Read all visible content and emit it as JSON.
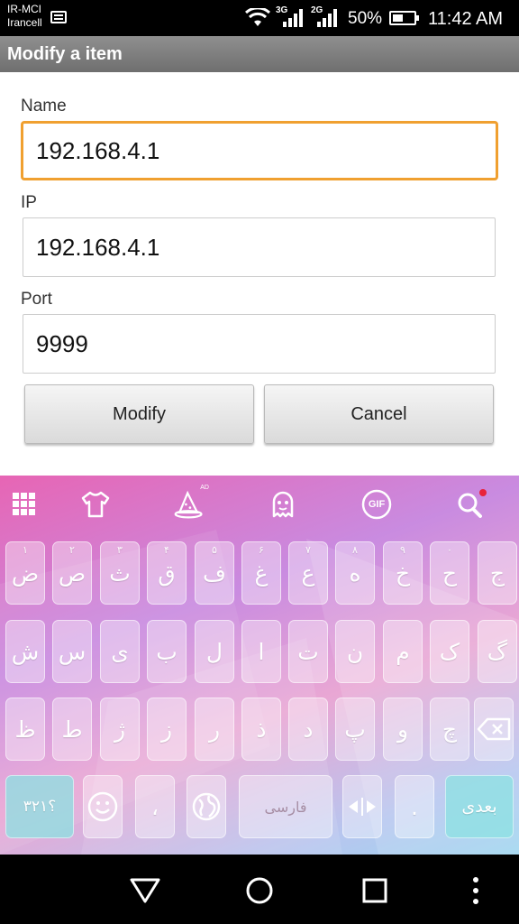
{
  "status_bar": {
    "carrier_line1": "IR-MCI",
    "carrier_line2": "Irancell",
    "network1": "3G",
    "network2": "2G",
    "battery_percent": "50%",
    "battery_level": 0.5,
    "time": "11:42 AM"
  },
  "title_bar": {
    "title": "Modify a item"
  },
  "form": {
    "name_label": "Name",
    "name_value": "192.168.4.1",
    "ip_label": "IP",
    "ip_value": "192.168.4.1",
    "port_label": "Port",
    "port_value": "9999"
  },
  "buttons": {
    "modify": "Modify",
    "cancel": "Cancel"
  },
  "keyboard": {
    "toolbar_icons": [
      "grid-menu-icon",
      "tshirt-theme-icon",
      "wizard-hat-ad-icon",
      "ghost-sticker-icon",
      "gif-icon",
      "search-icon"
    ],
    "toolbar_ad_label": "AD",
    "toolbar_gif_label": "GIF",
    "row1": [
      {
        "char": "ض",
        "sub": "۱"
      },
      {
        "char": "ص",
        "sub": "۲"
      },
      {
        "char": "ث",
        "sub": "۳"
      },
      {
        "char": "ق",
        "sub": "۴"
      },
      {
        "char": "ف",
        "sub": "۵"
      },
      {
        "char": "غ",
        "sub": "۶"
      },
      {
        "char": "ع",
        "sub": "۷"
      },
      {
        "char": "ه",
        "sub": "۸"
      },
      {
        "char": "خ",
        "sub": "۹"
      },
      {
        "char": "ح",
        "sub": "۰"
      },
      {
        "char": "ج",
        "sub": ""
      }
    ],
    "row2": [
      "ش",
      "س",
      "ی",
      "ب",
      "ل",
      "ا",
      "ت",
      "ن",
      "م",
      "ک",
      "گ"
    ],
    "row3": [
      "ظ",
      "ط",
      "ژ",
      "ز",
      "ر",
      "ذ",
      "د",
      "پ",
      "و",
      "چ"
    ],
    "numbers_key": "؟۳۲۱",
    "comma_key": "،",
    "space_label": "فارسی",
    "period_key": ".",
    "next_key": "بعدی",
    "accent_color": "#e765b4"
  },
  "nav_bar": {
    "back": "back-triangle-icon",
    "home": "home-circle-icon",
    "recents": "recents-square-icon",
    "menu": "overflow-menu-icon"
  }
}
